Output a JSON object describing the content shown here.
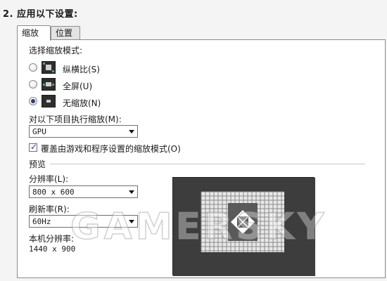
{
  "section": {
    "title": "2. 应用以下设置:"
  },
  "tabs": [
    {
      "label": "缩放",
      "active": true
    },
    {
      "label": "位置",
      "active": false
    }
  ],
  "scaling_mode": {
    "heading": "选择缩放模式:",
    "options": [
      {
        "label": "纵横比(S)",
        "checked": false,
        "icon": "aspect-ratio-icon"
      },
      {
        "label": "全屏(U)",
        "checked": false,
        "icon": "fullscreen-icon"
      },
      {
        "label": "无缩放(N)",
        "checked": true,
        "icon": "no-scaling-icon"
      }
    ]
  },
  "perform_scaling": {
    "label": "对以下项目执行缩放(M):",
    "value": "GPU"
  },
  "override": {
    "label": "覆盖由游戏和程序设置的缩放模式(O)",
    "checked": true
  },
  "preview": {
    "heading": "预览"
  },
  "resolution": {
    "label": "分辨率(L):",
    "value": "800 x 600"
  },
  "refresh": {
    "label": "刷新率(R):",
    "value": "60Hz"
  },
  "native": {
    "label": "本机分辨率:",
    "value": "1440 x 900"
  },
  "watermark": {
    "text": "GAMERSKY"
  },
  "colors": {
    "radio_dot": "#2a3f6e",
    "preview_bg": "#3d3d3d",
    "checkbox_tick": "#1d3f8a"
  }
}
